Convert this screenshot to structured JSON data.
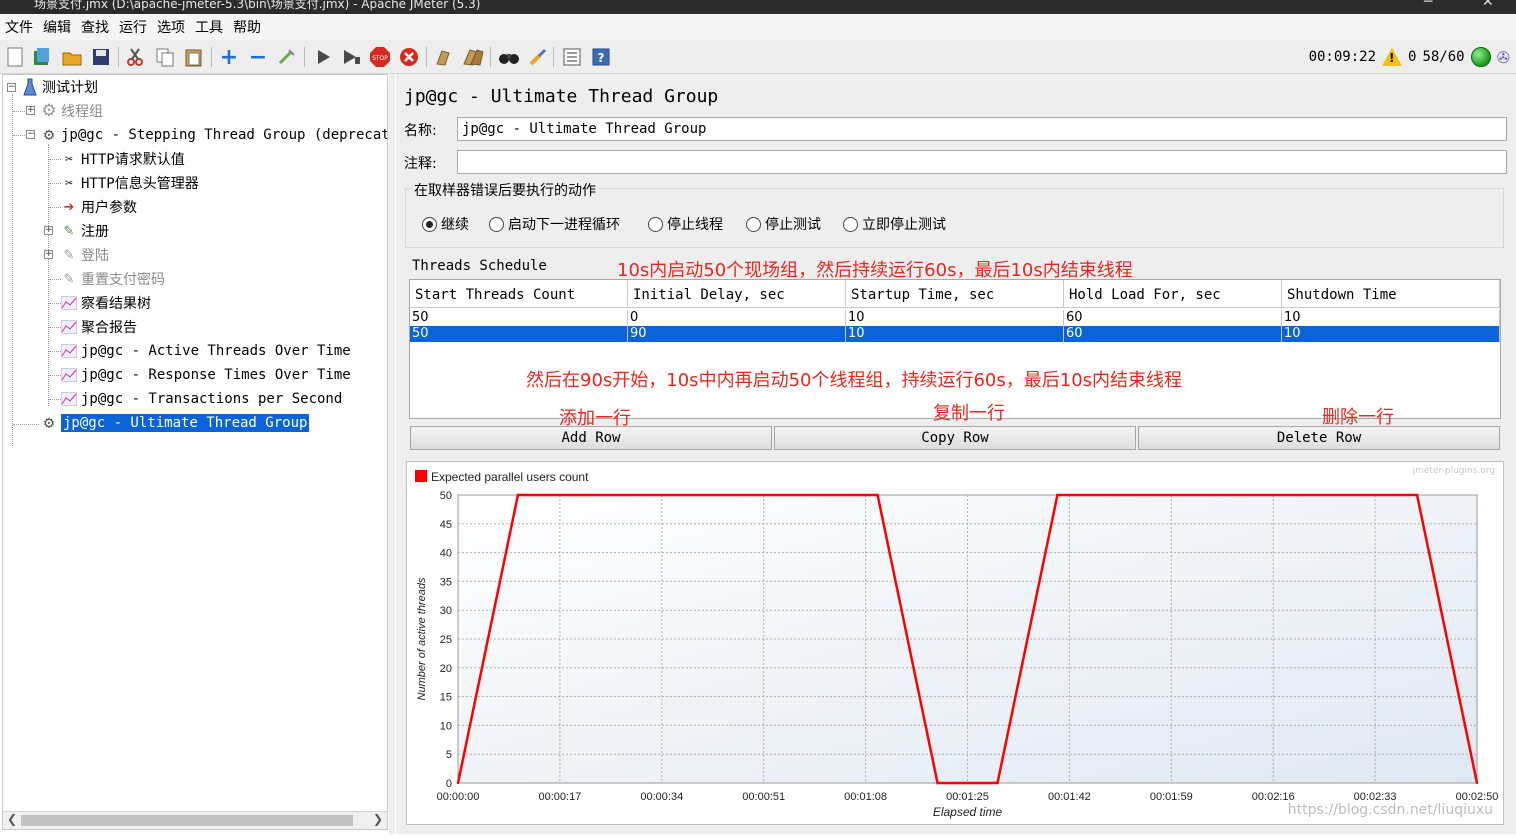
{
  "window": {
    "title": "场景支付.jmx (D:\\apache-jmeter-5.3\\bin\\场景支付.jmx) - Apache JMeter (5.3)"
  },
  "menu": [
    "文件",
    "编辑",
    "查找",
    "运行",
    "选项",
    "工具",
    "帮助"
  ],
  "toolbar": {
    "icons": [
      "new-icon",
      "templates-icon",
      "open-icon",
      "save-icon",
      "cut-icon",
      "copy-icon",
      "paste-icon",
      "expand-icon",
      "collapse-icon",
      "toggle-icon",
      "start-icon",
      "start-no-pause-icon",
      "stop-icon",
      "shutdown-icon",
      "clear-icon",
      "clear-all-icon",
      "search-icon",
      "reset-search-icon",
      "function-helper-icon",
      "help-icon"
    ],
    "elapsed": "00:09:22",
    "warnings": "0",
    "threads": "58/60"
  },
  "tree": {
    "root": "测试计划",
    "items": [
      {
        "label": "线程组",
        "icon": "gear-icon",
        "disabled": true
      },
      {
        "label": "jp@gc - Stepping Thread Group (deprecated)",
        "icon": "gear-icon",
        "disabled": false
      },
      {
        "label": "HTTP请求默认值",
        "icon": "wrench-icon",
        "disabled": false
      },
      {
        "label": "HTTP信息头管理器",
        "icon": "wrench-icon",
        "disabled": false
      },
      {
        "label": "用户参数",
        "icon": "arrow-icon",
        "disabled": false
      },
      {
        "label": "注册",
        "icon": "pipette-icon",
        "disabled": false
      },
      {
        "label": "登陆",
        "icon": "pipette-icon",
        "disabled": true
      },
      {
        "label": "重置支付密码",
        "icon": "pipette-icon",
        "disabled": true
      },
      {
        "label": "察看结果树",
        "icon": "graph-icon",
        "disabled": false
      },
      {
        "label": "聚合报告",
        "icon": "graph-icon",
        "disabled": false
      },
      {
        "label": "jp@gc - Active Threads Over Time",
        "icon": "graph-icon",
        "disabled": false
      },
      {
        "label": "jp@gc - Response Times Over Time",
        "icon": "graph-icon",
        "disabled": false
      },
      {
        "label": "jp@gc - Transactions per Second",
        "icon": "graph-icon",
        "disabled": false
      },
      {
        "label": "jp@gc - Ultimate Thread Group",
        "icon": "gear-icon",
        "disabled": false,
        "selected": true
      }
    ]
  },
  "panel": {
    "title": "jp@gc - Ultimate Thread Group",
    "name_label": "名称:",
    "name_value": "jp@gc - Ultimate Thread Group",
    "comment_label": "注释:",
    "comment_value": "",
    "error_action_title": "在取样器错误后要执行的动作",
    "error_actions": [
      {
        "label": "继续",
        "selected": true
      },
      {
        "label": "启动下一进程循环",
        "selected": false
      },
      {
        "label": "停止线程",
        "selected": false
      },
      {
        "label": "停止测试",
        "selected": false
      },
      {
        "label": "立即停止测试",
        "selected": false
      }
    ],
    "schedule_title": "Threads Schedule",
    "columns": [
      "Start Threads Count",
      "Initial Delay, sec",
      "Startup Time, sec",
      "Hold Load For, sec",
      "Shutdown Time"
    ],
    "rows": [
      [
        "50",
        "0",
        "10",
        "60",
        "10"
      ],
      [
        "50",
        "90",
        "10",
        "60",
        "10"
      ]
    ],
    "buttons": {
      "add": "Add Row",
      "copy": "Copy Row",
      "delete": "Delete Row"
    }
  },
  "annotations": {
    "row1": "10s内启动50个现场组，然后持续运行60s，最后10s内结束线程",
    "row2": "然后在90s开始，10s中内再启动50个线程组，持续运行60s，最后10s内结束线程",
    "add": "添加一行",
    "copy": "复制一行",
    "delete": "删除一行"
  },
  "chart_data": {
    "type": "line",
    "legend": "Expected parallel users count",
    "legend_position": "top-left",
    "xlabel": "Elapsed time",
    "ylabel": "Number of active threads",
    "ylim": [
      0,
      50
    ],
    "yticks": [
      "0",
      "5",
      "10",
      "15",
      "20",
      "25",
      "30",
      "35",
      "40",
      "45",
      "50"
    ],
    "xlim": [
      0,
      170
    ],
    "xticks": [
      {
        "value": 0,
        "label": "00:00:00"
      },
      {
        "value": 17,
        "label": "00:00:17"
      },
      {
        "value": 34,
        "label": "00:00:34"
      },
      {
        "value": 51,
        "label": "00:00:51"
      },
      {
        "value": 68,
        "label": "00:01:08"
      },
      {
        "value": 85,
        "label": "00:01:25"
      },
      {
        "value": 102,
        "label": "00:01:42"
      },
      {
        "value": 119,
        "label": "00:01:59"
      },
      {
        "value": 136,
        "label": "00:02:16"
      },
      {
        "value": 153,
        "label": "00:02:33"
      },
      {
        "value": 170,
        "label": "00:02:50"
      }
    ],
    "series": [
      {
        "name": "Expected parallel users count",
        "color": "#ff0000",
        "x": [
          0,
          10,
          70,
          80,
          90,
          100,
          160,
          170
        ],
        "y": [
          0,
          50,
          50,
          0,
          0,
          50,
          50,
          0
        ]
      }
    ],
    "grid": true,
    "watermark": "jmeter-plugins.org"
  },
  "watermark": "https://blog.csdn.net/liuqiuxu"
}
